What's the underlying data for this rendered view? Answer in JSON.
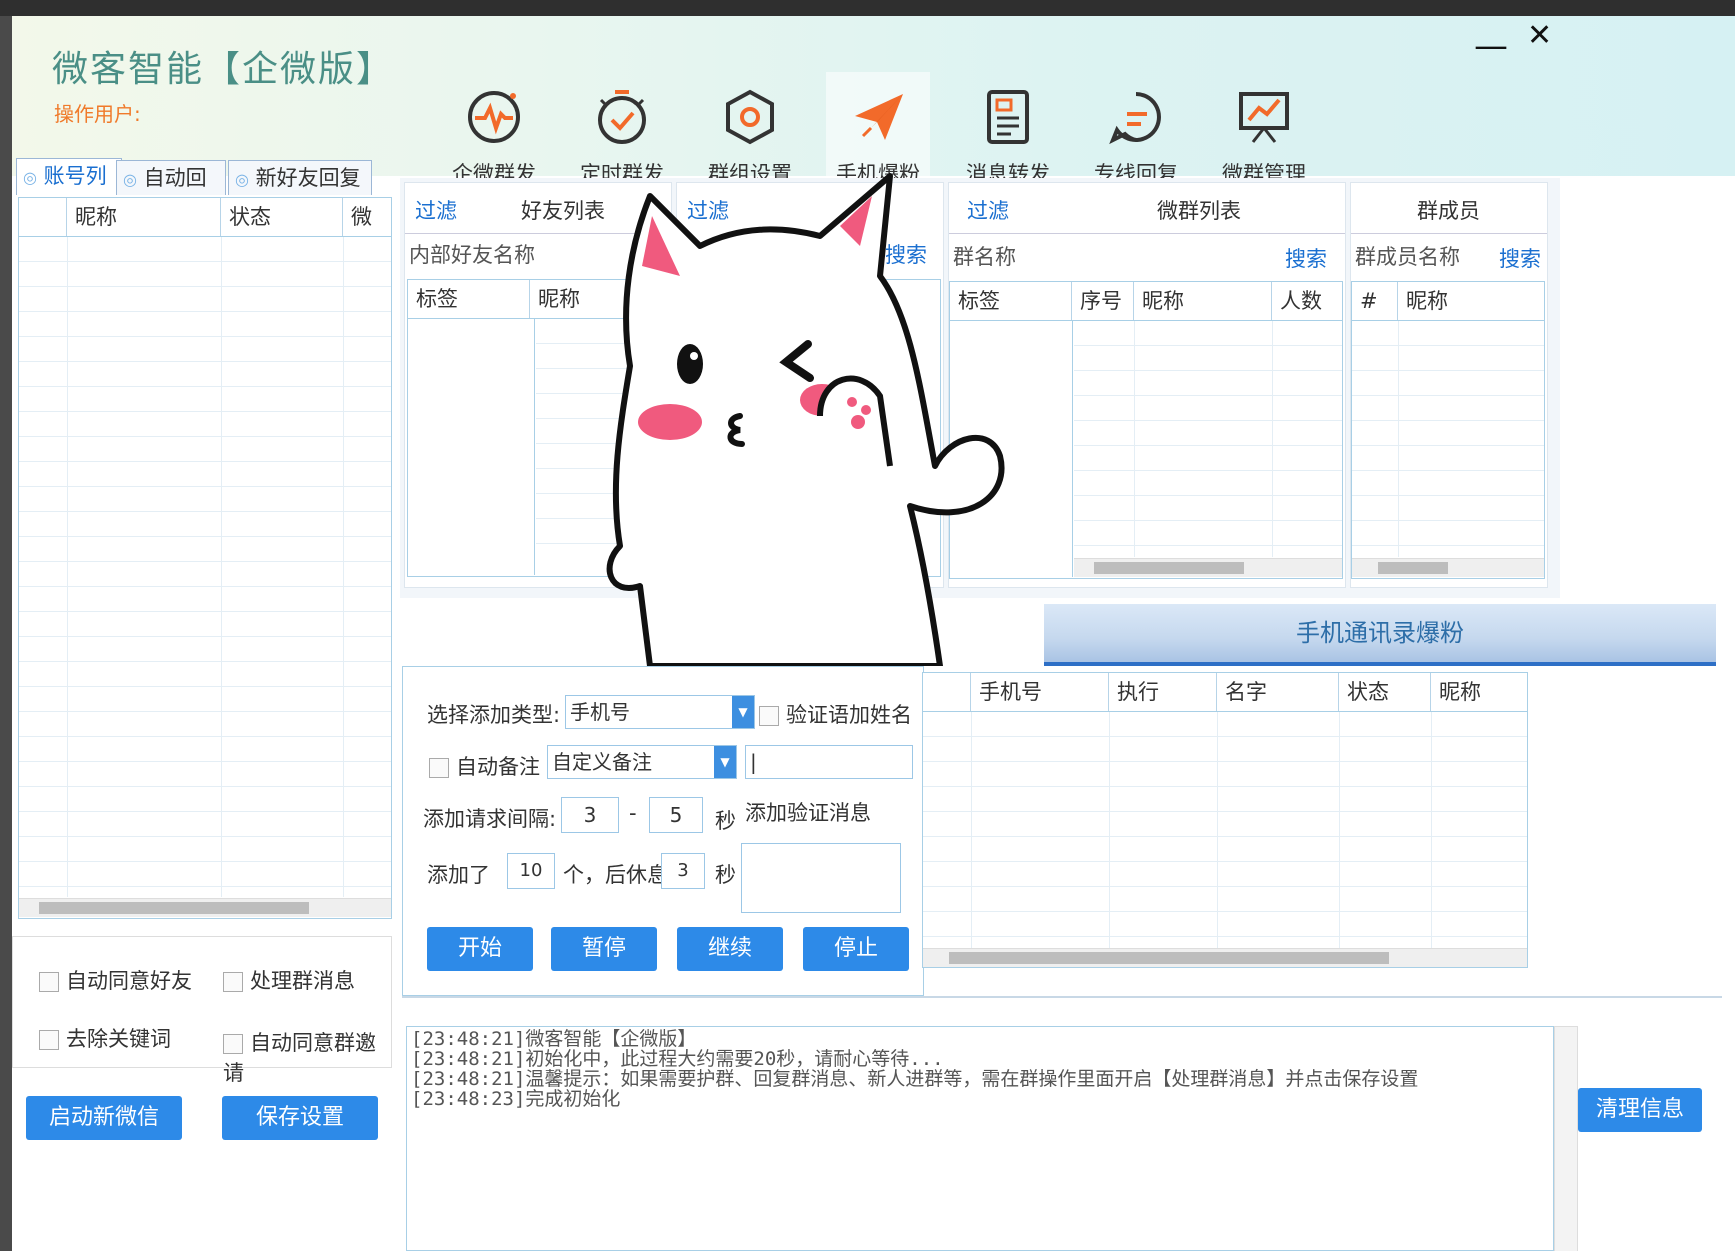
{
  "app": {
    "title": "微客智能【企微版】",
    "operator_label": "操作用户:",
    "minimize": "—",
    "close": "✕"
  },
  "nav": [
    {
      "label": "企微群发",
      "icon": "pulse-icon"
    },
    {
      "label": "定时群发",
      "icon": "timer-icon"
    },
    {
      "label": "群组设置",
      "icon": "hexagon-gear-icon"
    },
    {
      "label": "手机爆粉",
      "icon": "paper-plane-icon"
    },
    {
      "label": "消息转发",
      "icon": "document-icon"
    },
    {
      "label": "专线回复",
      "icon": "chat-bubble-icon"
    },
    {
      "label": "微群管理",
      "icon": "presentation-chart-icon"
    }
  ],
  "left_tabs": [
    "账号列",
    "自动回复",
    "新好友回复"
  ],
  "account_table": {
    "headers": [
      "昵称",
      "状态",
      "微"
    ]
  },
  "options": {
    "auto_accept_friend": "自动同意好友",
    "handle_group_msg": "处理群消息",
    "remove_keywords": "去除关键词",
    "auto_accept_group": "自动同意群邀请"
  },
  "left_buttons": {
    "start_wechat": "启动新微信",
    "save_settings": "保存设置"
  },
  "friends_panel": {
    "filter": "过滤",
    "title": "好友列表",
    "search_label": "内部好友名称",
    "headers": [
      "标签",
      "昵称"
    ]
  },
  "middle_panel": {
    "filter": "过滤",
    "search": "搜索"
  },
  "groups_panel": {
    "filter": "过滤",
    "title": "微群列表",
    "search_label": "群名称",
    "search": "搜索",
    "headers": [
      "标签",
      "序号",
      "昵称",
      "人数"
    ]
  },
  "members_panel": {
    "title": "群成员",
    "search_label": "群成员名称",
    "search": "搜索",
    "headers": [
      "#",
      "昵称"
    ]
  },
  "banner": "手机通讯录爆粉",
  "form": {
    "type_label": "选择添加类型:",
    "type_value": "手机号",
    "verify_name": "验证语加姓名",
    "auto_note": "自动备注",
    "note_value": "自定义备注",
    "note_input": "|",
    "interval_label": "添加请求间隔:",
    "interval_min": "3",
    "dash": "-",
    "interval_max": "5",
    "sec": "秒",
    "verify_msg_label": "添加验证消息",
    "added_label": "添加了",
    "added_count": "10",
    "rest_label": "个，后休息",
    "rest_value": "3",
    "sec2": "秒"
  },
  "control_buttons": [
    "开始",
    "暂停",
    "继续",
    "停止"
  ],
  "phone_table": {
    "headers": [
      "手机号",
      "执行",
      "名字",
      "状态",
      "昵称"
    ]
  },
  "log": [
    "[23:48:21]微客智能【企微版】",
    "[23:48:21]初始化中，此过程大约需要20秒，请耐心等待...",
    "[23:48:21]温馨提示：如果需要护群、回复群消息、新人进群等，需在群操作里面开启【处理群消息】并点击保存设置",
    "[23:48:23]完成初始化"
  ],
  "clear_button": "清理信息",
  "colors": {
    "accent": "#2d8ae8",
    "title": "#4a8f86",
    "operator": "#f07a2a",
    "nav_active": "#f26a2a"
  }
}
